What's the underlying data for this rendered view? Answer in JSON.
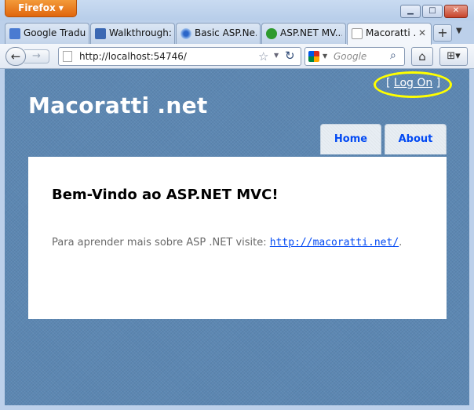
{
  "browser": {
    "app_button": "Firefox",
    "tabs": [
      {
        "label": "Google Tradu...",
        "icon": "google-translate-icon",
        "color": "#4a7bd1"
      },
      {
        "label": "Walkthrough:...",
        "icon": "visual-studio-icon",
        "color": "#3b68b3"
      },
      {
        "label": "Basic ASP.Ne...",
        "icon": "aspnet-icon",
        "color": "#6aa1e6"
      },
      {
        "label": "ASP.NET MV...",
        "icon": "green-arrow-icon",
        "color": "#2e9a2e"
      },
      {
        "label": "Macoratti ...",
        "icon": "page-icon",
        "color": "#ffffff"
      }
    ],
    "url": "http://localhost:54746/",
    "search_placeholder": "Google"
  },
  "page": {
    "login": {
      "open_bracket": "[",
      "link": "Log On",
      "close_bracket": "]"
    },
    "site_title": "Macoratti .net",
    "menu": [
      "Home",
      "About"
    ],
    "heading": "Bem-Vindo ao ASP.NET MVC!",
    "text_prefix": "Para aprender mais sobre ASP .NET visite: ",
    "link": "http://macoratti.net/",
    "text_suffix": ".",
    "highlight_color": "#ffff00",
    "accent_color": "#034af3",
    "background_color": "#5c87b2"
  }
}
